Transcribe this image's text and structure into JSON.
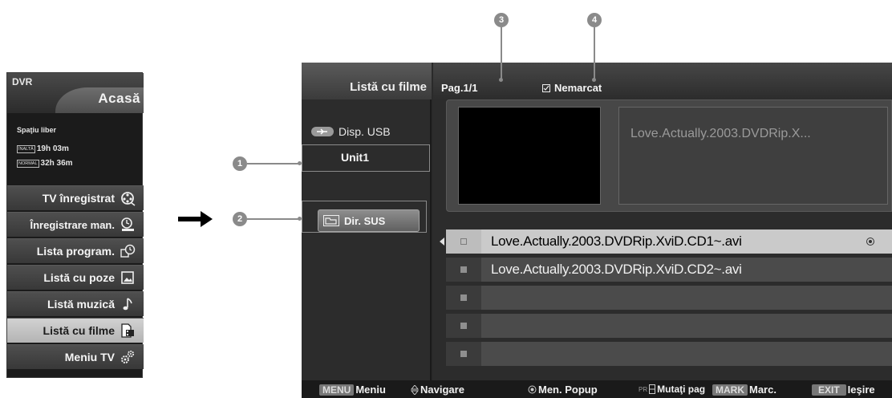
{
  "dvr_menu": {
    "title": "DVR",
    "home": "Acasă",
    "free_space_label": "Spaţiu liber",
    "quality": [
      {
        "badge": "ÎNALTĂ",
        "time": "19h 03m"
      },
      {
        "badge": "NORMAL",
        "time": "32h 36m"
      }
    ],
    "items": [
      {
        "label": "TV înregistrat",
        "icon": "film-reel-icon"
      },
      {
        "label": "Înregistrare man.",
        "icon": "manual-record-clock-icon"
      },
      {
        "label": "Lista program.",
        "icon": "schedule-clock-icon"
      },
      {
        "label": "Listă cu poze",
        "icon": "photo-icon"
      },
      {
        "label": "Listă muzică",
        "icon": "music-note-icon"
      },
      {
        "label": "Listă cu filme",
        "icon": "movie-file-icon",
        "selected": true
      },
      {
        "label": "Meniu TV",
        "icon": "gears-icon"
      }
    ]
  },
  "callouts": [
    "1",
    "2",
    "3",
    "4"
  ],
  "screen": {
    "list_title": "Listă cu filme",
    "page": "Pag.1/1",
    "unmark": "Nemarcat",
    "usb_device": "Disp. USB",
    "unit": "Unit1",
    "dir_up": "Dir. SUS",
    "selected_file_title": "Love.Actually.2003.DVDRip.X...",
    "files": [
      "Love.Actually.2003.DVDRip.XviD.CD1~.avi",
      "Love.Actually.2003.DVDRip.XviD.CD2~.avi",
      "",
      "",
      ""
    ],
    "hints": {
      "menu_key": "MENU",
      "menu_label": "Meniu",
      "nav_label": "Navigare",
      "popup_label": "Men. Popup",
      "pr_key": "PR",
      "move_page_label": "Mutaţi pag",
      "mark_key": "MARK",
      "mark_label": "Marc.",
      "exit_key": "EXIT",
      "exit_label": "Ieşire"
    }
  },
  "colors": {
    "selected_row": "#cacaca",
    "callout": "#8a8a8a",
    "panel": "#2c2c2c"
  }
}
